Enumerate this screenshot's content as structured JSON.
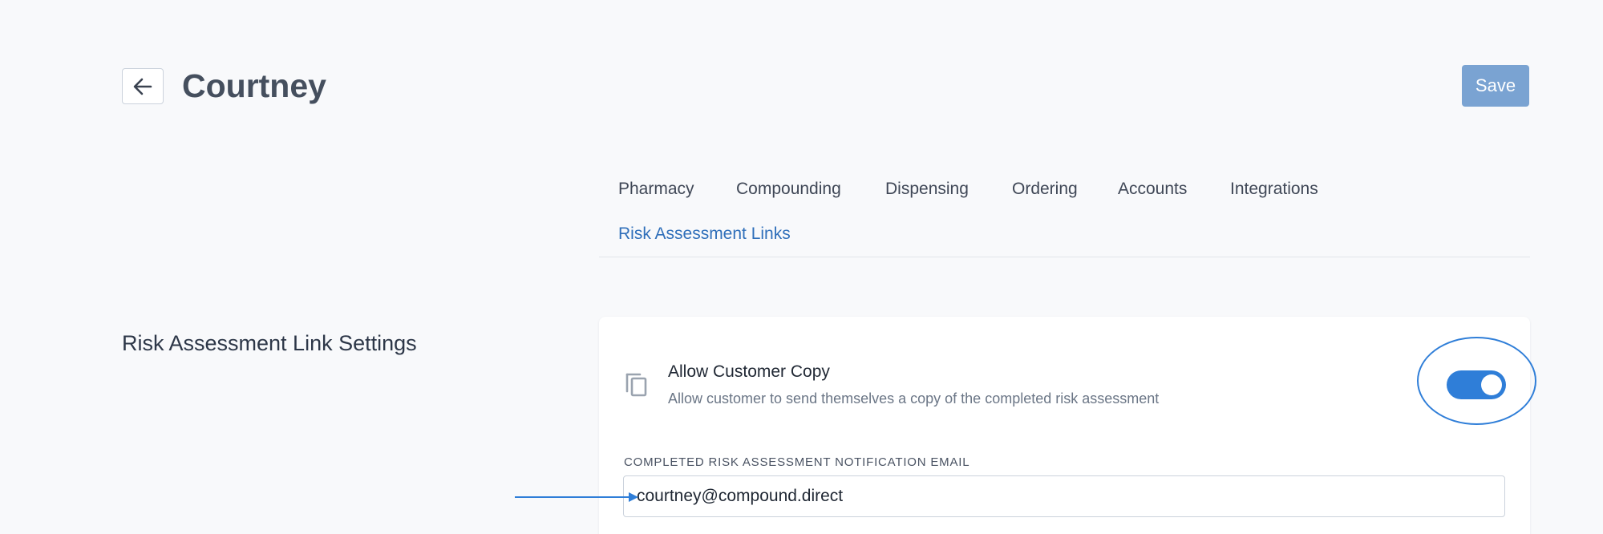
{
  "header": {
    "title": "Courtney",
    "back_icon": "arrow-left-icon",
    "save_label": "Save"
  },
  "tabs": [
    {
      "label": "Pharmacy",
      "active": false
    },
    {
      "label": "Compounding",
      "active": false
    },
    {
      "label": "Dispensing",
      "active": false
    },
    {
      "label": "Ordering",
      "active": false
    },
    {
      "label": "Accounts",
      "active": false
    },
    {
      "label": "Integrations",
      "active": false
    },
    {
      "label": "Risk Assessment Links",
      "active": true
    }
  ],
  "section": {
    "heading": "Risk Assessment Link Settings",
    "setting": {
      "icon": "copy-icon",
      "title": "Allow Customer Copy",
      "description": "Allow customer to send themselves a copy of the completed risk assessment",
      "enabled": true
    },
    "email_field": {
      "label": "COMPLETED RISK ASSESSMENT NOTIFICATION EMAIL",
      "value": "courtney@compound.direct"
    }
  },
  "colors": {
    "accent": "#2f7ed8",
    "save_button": "#7aa3d2",
    "active_tab": "#2f6fba",
    "background": "#f8f9fb"
  }
}
